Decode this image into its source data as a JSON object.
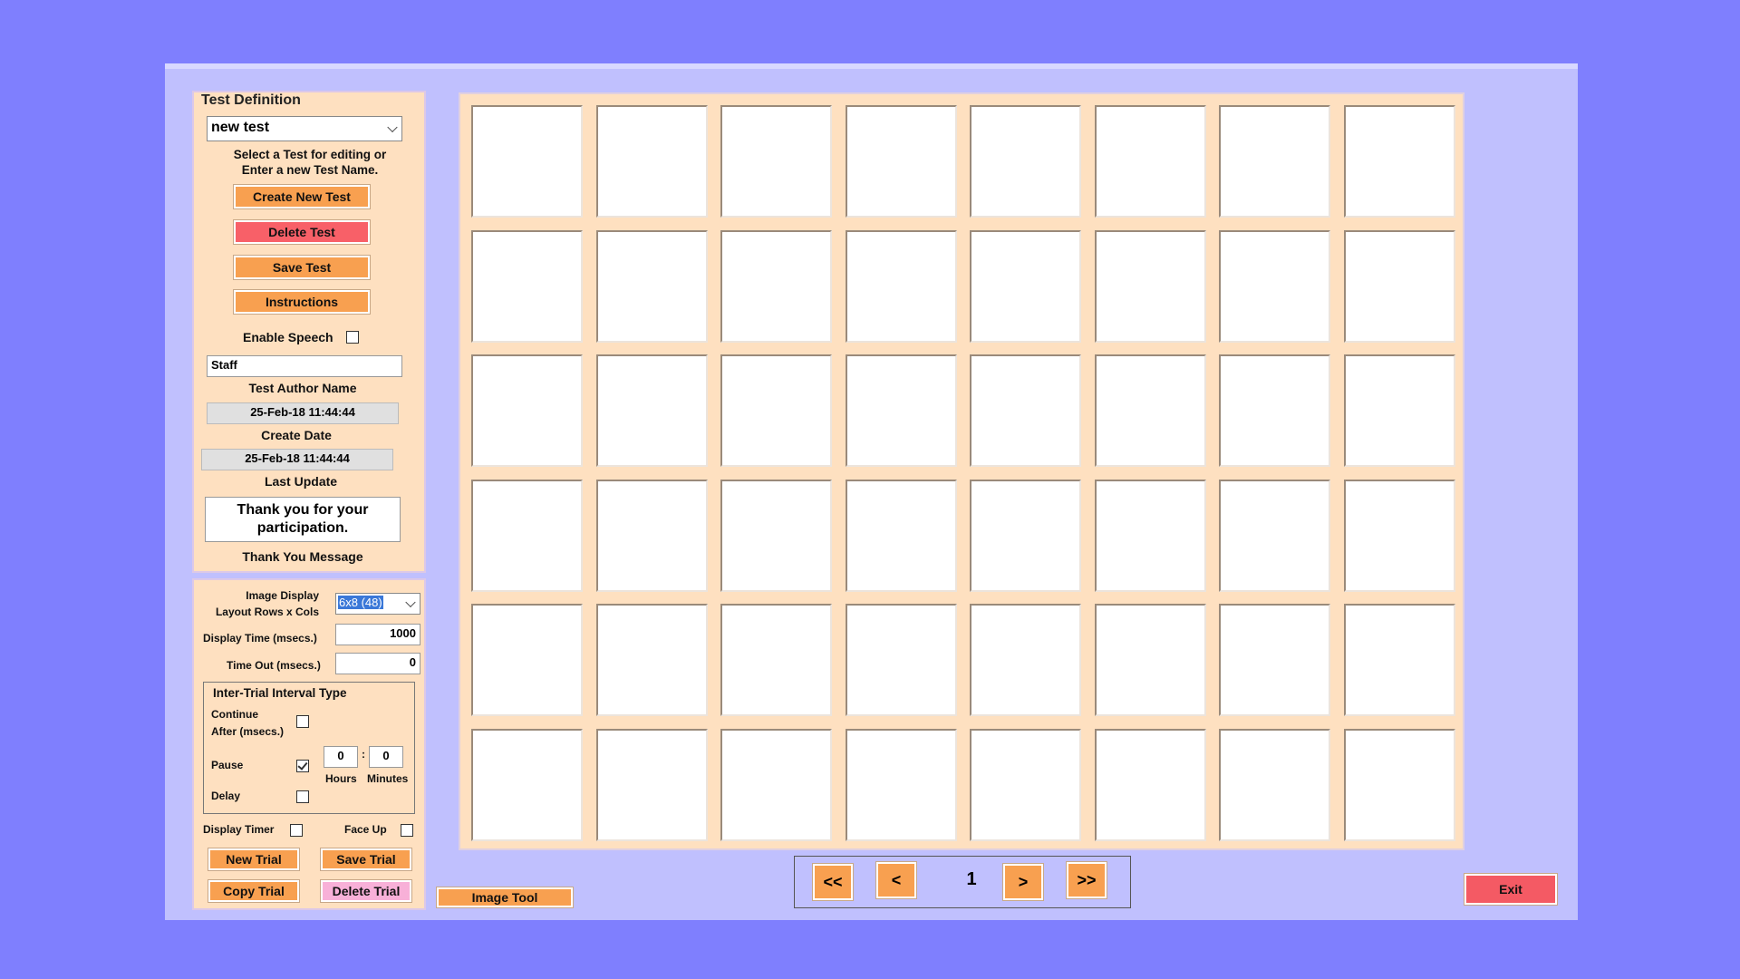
{
  "test_definition": {
    "title": "Test Definition",
    "test_select_value": "new test",
    "select_hint": "Select a Test for editing or\nEnter a new Test Name.",
    "create_new_test": "Create New Test",
    "delete_test": "Delete Test",
    "save_test": "Save Test",
    "instructions": "Instructions",
    "enable_speech_label": "Enable Speech",
    "enable_speech_checked": false,
    "author_value": "Staff",
    "author_label": "Test Author Name",
    "create_date_value": "25-Feb-18 11:44:44",
    "create_date_label": "Create Date",
    "last_update_value": "25-Feb-18 11:44:44",
    "last_update_label": "Last Update",
    "thank_you_value": "Thank you for your participation.",
    "thank_you_label": "Thank You Message"
  },
  "trial_settings": {
    "layout_label": "Image Display\nLayout Rows x Cols",
    "layout_value": "6x8 (48)",
    "display_time_label": "Display Time (msecs.)",
    "display_time_value": "1000",
    "timeout_label": "Time Out (msecs.)",
    "timeout_value": "0",
    "iti_title": "Inter-Trial Interval Type",
    "continue_label": "Continue\nAfter (msecs.)",
    "continue_checked": false,
    "pause_label": "Pause",
    "pause_checked": true,
    "hours_value": "0",
    "minutes_value": "0",
    "colon": ":",
    "hours_label": "Hours",
    "minutes_label": "Minutes",
    "delay_label": "Delay",
    "delay_checked": false,
    "display_timer_label": "Display Timer",
    "display_timer_checked": false,
    "face_up_label": "Face Up",
    "face_up_checked": false,
    "new_trial": "New Trial",
    "save_trial": "Save Trial",
    "copy_trial": "Copy Trial",
    "delete_trial": "Delete Trial"
  },
  "image_tool": "Image Tool",
  "grid": {
    "rows": 6,
    "cols": 8
  },
  "navigator": {
    "first": "<<",
    "prev": "<",
    "page": "1",
    "next": ">",
    "last": ">>"
  },
  "exit": "Exit",
  "colors": {
    "background": "#7f7ffe",
    "window": "#c0c0fe",
    "panel": "#fee0c0",
    "button_orange": "#f8a050",
    "button_red": "#f86068",
    "button_pink": "#f8b0d8"
  }
}
